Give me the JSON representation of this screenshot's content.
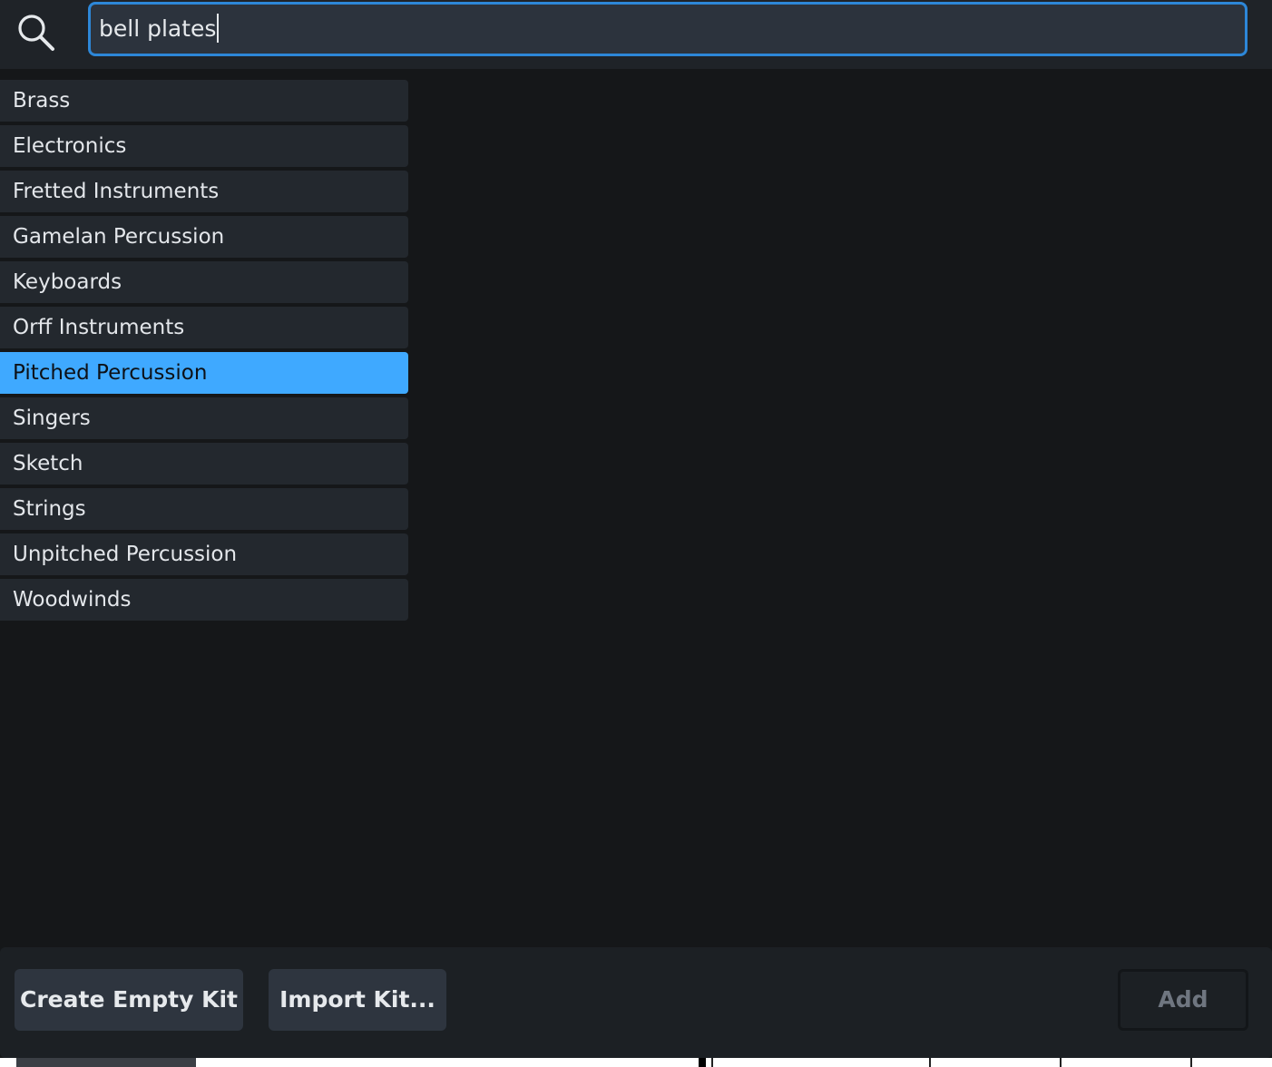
{
  "search": {
    "value": "bell plates"
  },
  "categories": [
    {
      "label": "Brass",
      "selected": false
    },
    {
      "label": "Electronics",
      "selected": false
    },
    {
      "label": "Fretted Instruments",
      "selected": false
    },
    {
      "label": "Gamelan Percussion",
      "selected": false
    },
    {
      "label": "Keyboards",
      "selected": false
    },
    {
      "label": "Orff Instruments",
      "selected": false
    },
    {
      "label": "Pitched Percussion",
      "selected": true
    },
    {
      "label": "Singers",
      "selected": false
    },
    {
      "label": "Sketch",
      "selected": false
    },
    {
      "label": "Strings",
      "selected": false
    },
    {
      "label": "Unpitched Percussion",
      "selected": false
    },
    {
      "label": "Woodwinds",
      "selected": false
    }
  ],
  "footer": {
    "create_label": "Create Empty Kit",
    "import_label": "Import Kit...",
    "add_label": "Add"
  },
  "colors": {
    "accent": "#3fa9ff",
    "focus_border": "#2d87d8",
    "background": "#151719"
  },
  "icons": {
    "search": "search-icon"
  }
}
